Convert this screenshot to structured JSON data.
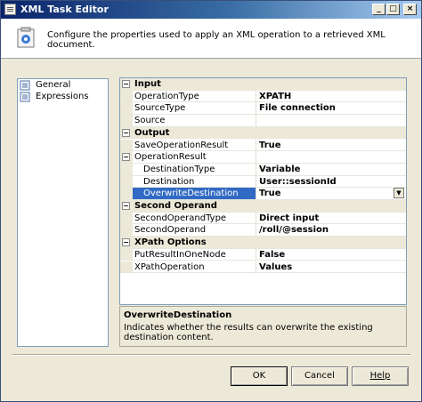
{
  "window": {
    "title": "XML Task Editor",
    "minimize_glyph": "_",
    "maximize_glyph": "□",
    "close_glyph": "×"
  },
  "header": {
    "description": "Configure the properties used to apply an XML operation to a retrieved XML document."
  },
  "nav": {
    "items": [
      {
        "label": "General",
        "icon": "page-icon",
        "selected": true
      },
      {
        "label": "Expressions",
        "icon": "page-icon",
        "selected": false
      }
    ]
  },
  "grid": {
    "rows": [
      {
        "kind": "category",
        "name": "Input",
        "expander": "⊟"
      },
      {
        "kind": "prop",
        "indent": 1,
        "name": "OperationType",
        "value": "XPATH"
      },
      {
        "kind": "prop",
        "indent": 1,
        "name": "SourceType",
        "value": "File connection"
      },
      {
        "kind": "prop",
        "indent": 1,
        "name": "Source",
        "value": ""
      },
      {
        "kind": "category",
        "name": "Output",
        "expander": "⊟"
      },
      {
        "kind": "prop",
        "indent": 1,
        "name": "SaveOperationResult",
        "value": "True"
      },
      {
        "kind": "subcat",
        "indent": 1,
        "name": "OperationResult",
        "value": "",
        "expander": "⊟"
      },
      {
        "kind": "prop",
        "indent": 2,
        "name": "DestinationType",
        "value": "Variable"
      },
      {
        "kind": "prop",
        "indent": 2,
        "name": "Destination",
        "value": "User::sessionId"
      },
      {
        "kind": "prop",
        "indent": 2,
        "name": "OverwriteDestination",
        "value": "True",
        "selected": true
      },
      {
        "kind": "category",
        "name": "Second Operand",
        "expander": "⊟"
      },
      {
        "kind": "prop",
        "indent": 1,
        "name": "SecondOperandType",
        "value": "Direct input"
      },
      {
        "kind": "prop",
        "indent": 1,
        "name": "SecondOperand",
        "value": "/roll/@session"
      },
      {
        "kind": "category",
        "name": "XPath Options",
        "expander": "⊟"
      },
      {
        "kind": "prop",
        "indent": 1,
        "name": "PutResultInOneNode",
        "value": "False"
      },
      {
        "kind": "prop",
        "indent": 1,
        "name": "XPathOperation",
        "value": "Values"
      }
    ],
    "dropdown_glyph": "▼"
  },
  "description": {
    "title": "OverwriteDestination",
    "text": "Indicates whether the results can overwrite the existing destination content."
  },
  "buttons": {
    "ok": "OK",
    "cancel": "Cancel",
    "help": "Help"
  },
  "colors": {
    "selection": "#316ac5",
    "title_gradient_start": "#0a246a"
  }
}
